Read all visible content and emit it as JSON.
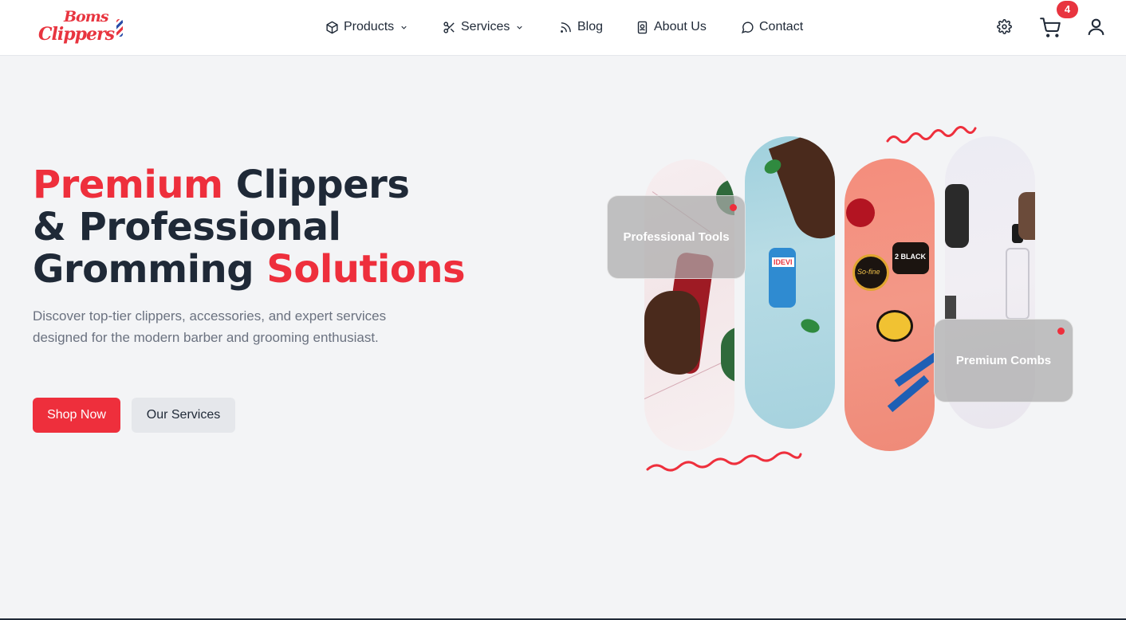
{
  "brand": {
    "line1": "Boms",
    "line2": "Clippers"
  },
  "nav": {
    "products": "Products",
    "services": "Services",
    "blog": "Blog",
    "about": "About Us",
    "contact": "Contact"
  },
  "cart": {
    "count": "4"
  },
  "hero": {
    "title_1": "Premium",
    "title_2": " Clippers",
    "title_3": "& Professional",
    "title_4": "Gromming ",
    "title_5": "Solutions",
    "description": "Discover top-tier clippers, accessories, and expert services designed for the modern barber and grooming enthusiast.",
    "primary_button": "Shop Now",
    "secondary_button": "Our Services"
  },
  "collage": {
    "card_1": "Professional Tools",
    "card_2": "Premium Combs",
    "product_label_1": "IDEVI",
    "product_label_2": "2 BLACK",
    "product_label_3": "So-fine"
  },
  "colors": {
    "accent": "#ee2f3c",
    "text": "#1f2937",
    "muted": "#6b7280",
    "background": "#f3f4f6"
  }
}
